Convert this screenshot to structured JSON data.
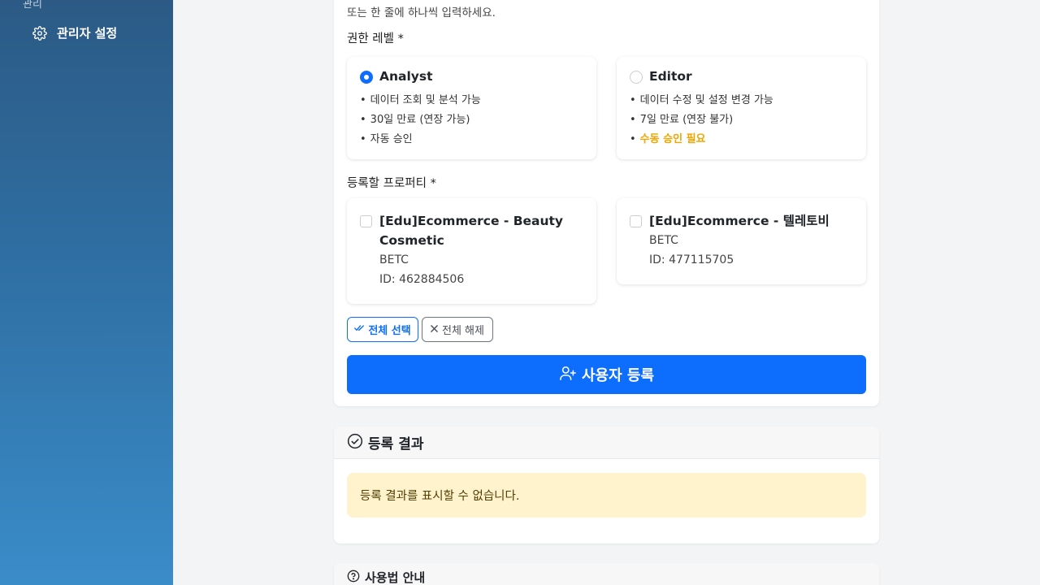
{
  "sidebar": {
    "section_label": "관리",
    "items": [
      {
        "label": "관리자 설정",
        "icon": "gear-icon"
      }
    ]
  },
  "form": {
    "hint": "또는 한 줄에 하나씩 입력하세요.",
    "permission_label": "권한 레벨 *",
    "options": [
      {
        "title": "Analyst",
        "checked": true,
        "bullets": [
          "데이터 조회 및 분석 가능",
          "30일 만료 (연장 가능)",
          "자동 승인"
        ]
      },
      {
        "title": "Editor",
        "checked": false,
        "bullets": [
          "데이터 수정 및 설정 변경 가능",
          "7일 만료 (연장 불가)",
          "수동 승인 필요"
        ]
      }
    ],
    "property_label": "등록할 프로퍼티 *",
    "properties": [
      {
        "title": "[Edu]Ecommerce - Beauty Cosmetic",
        "code": "BETC",
        "id": "ID: 462884506",
        "checked": false
      },
      {
        "title": "[Edu]Ecommerce - 텔레토비",
        "code": "BETC",
        "id": "ID: 477115705",
        "checked": false
      }
    ],
    "select_all_label": "전체 선택",
    "clear_all_label": "전체 해제",
    "submit_label": "사용자 등록"
  },
  "result": {
    "header": "등록 결과",
    "alert": "등록 결과를 표시할 수 없습니다."
  },
  "guide": {
    "header": "사용법 안내"
  },
  "colors": {
    "primary": "#0d6efd",
    "warning_text": "#f0a500",
    "alert_bg": "#fff3cd"
  }
}
